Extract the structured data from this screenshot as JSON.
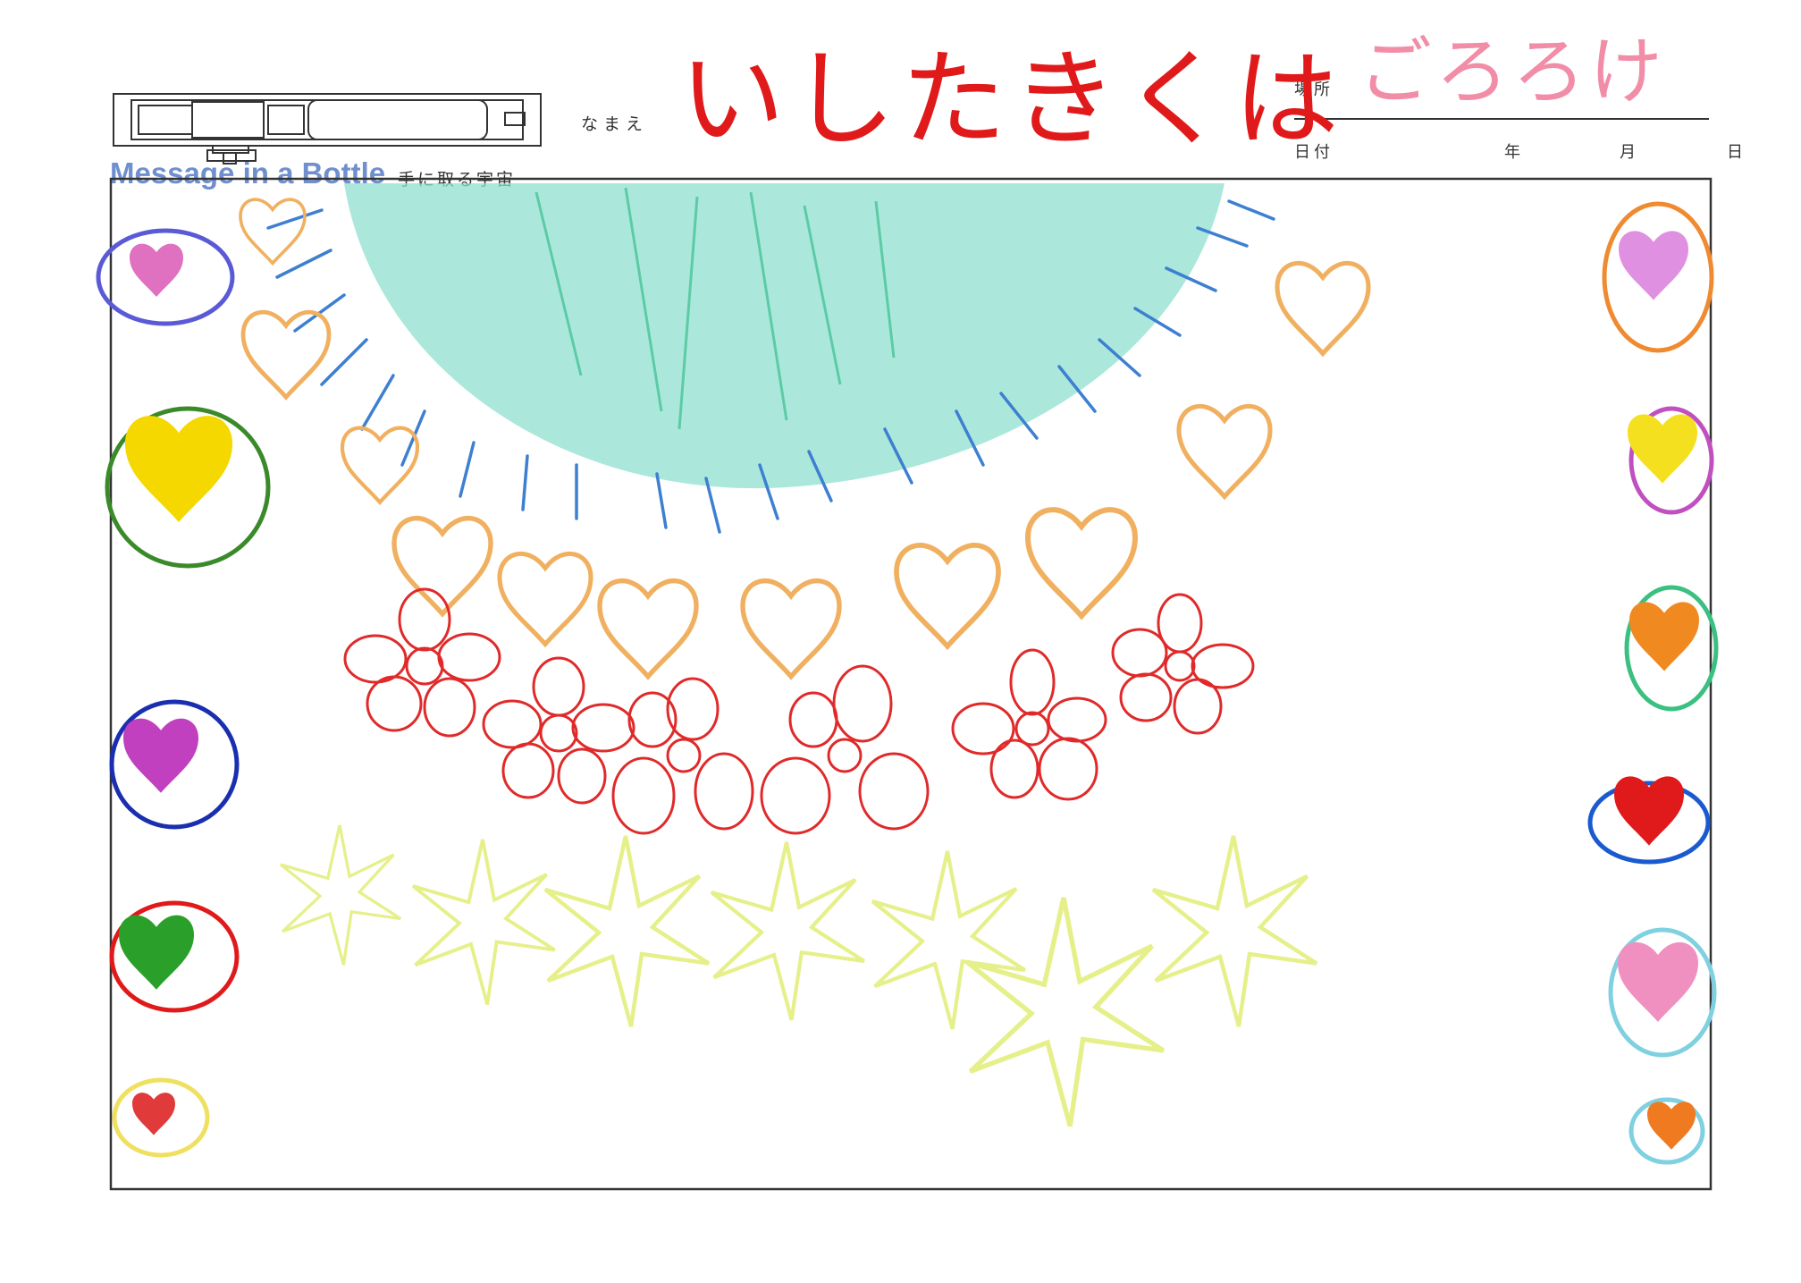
{
  "form": {
    "brand_title": "Message in a Bottle",
    "brand_subtitle": "手に取る宇宙",
    "name_label": "なまえ",
    "place_label": "場所",
    "date_label": "日付",
    "year_label": "年",
    "month_label": "月",
    "day_label": "日"
  },
  "handwriting": {
    "name_value": "いしたきくは",
    "place_value": "ごろろけ"
  },
  "colors": {
    "frame": "#333333",
    "brand": "#6f8fcf",
    "name_ink": "#e01a1a",
    "place_ink": "#f07a9a",
    "sun_fill": "#7fd9c9",
    "sun_rays": "#3d7fd1",
    "hearts_outline": "#f0b060",
    "flowers": "#e02a2a",
    "stars": "#e6f08a"
  }
}
